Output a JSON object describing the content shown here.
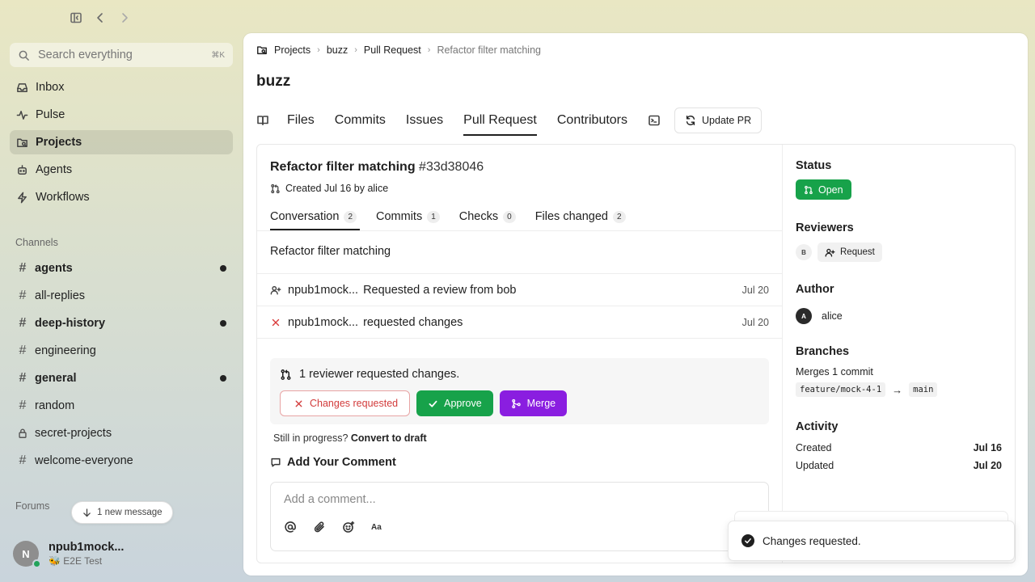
{
  "search": {
    "placeholder": "Search everything",
    "shortcut": "⌘K"
  },
  "nav": [
    {
      "label": "Inbox",
      "icon": "inbox-icon"
    },
    {
      "label": "Pulse",
      "icon": "pulse-icon"
    },
    {
      "label": "Projects",
      "icon": "projects-icon",
      "active": true
    },
    {
      "label": "Agents",
      "icon": "agents-icon"
    },
    {
      "label": "Workflows",
      "icon": "bolt-icon"
    }
  ],
  "channels_label": "Channels",
  "channels": [
    {
      "label": "agents",
      "unread": true
    },
    {
      "label": "all-replies",
      "unread": false
    },
    {
      "label": "deep-history",
      "unread": true
    },
    {
      "label": "engineering",
      "unread": false
    },
    {
      "label": "general",
      "unread": true
    },
    {
      "label": "random",
      "unread": false
    },
    {
      "label": "secret-projects",
      "unread": false,
      "locked": true
    },
    {
      "label": "welcome-everyone",
      "unread": false
    }
  ],
  "forums_label": "Forums",
  "new_message": "1 new message",
  "user": {
    "initial": "N",
    "name": "npub1mock...",
    "status": "🐝 E2E Test"
  },
  "breadcrumb": [
    "Projects",
    "buzz",
    "Pull Request",
    "Refactor filter matching"
  ],
  "page_title": "buzz",
  "tabs": [
    "Files",
    "Commits",
    "Issues",
    "Pull Request",
    "Contributors"
  ],
  "update_pr": "Update PR",
  "pr": {
    "title": "Refactor filter matching",
    "hash": "#33d38046",
    "created": "Created Jul 16 by alice",
    "subtabs": [
      {
        "label": "Conversation",
        "count": "2"
      },
      {
        "label": "Commits",
        "count": "1"
      },
      {
        "label": "Checks",
        "count": "0"
      },
      {
        "label": "Files changed",
        "count": "2"
      }
    ],
    "description": "Refactor filter matching",
    "events": [
      {
        "who": "npub1mock...",
        "text": "Requested a review from bob",
        "date": "Jul 20"
      },
      {
        "who": "npub1mock...",
        "text": "requested changes",
        "date": "Jul 20"
      }
    ],
    "merge_summary": "1 reviewer requested changes.",
    "btn_changes": "Changes requested",
    "btn_approve": "Approve",
    "btn_merge": "Merge",
    "draft_prefix": "Still in progress?",
    "draft_link": "Convert to draft",
    "add_comment": "Add Your Comment",
    "comment_placeholder": "Add a comment...",
    "comment_format": "Aa"
  },
  "side": {
    "status_h": "Status",
    "status": "Open",
    "reviewers_h": "Reviewers",
    "reviewer_initial": "B",
    "request": "Request",
    "author_h": "Author",
    "author_initial": "A",
    "author": "alice",
    "branches_h": "Branches",
    "merges": "Merges 1 commit",
    "from": "feature/mock-4-1",
    "arrow": "→",
    "to": "main",
    "activity_h": "Activity",
    "created_l": "Created",
    "created_v": "Jul 16",
    "updated_l": "Updated",
    "updated_v": "Jul 20"
  },
  "toast": "Changes requested.",
  "colors": {
    "green": "#17a24a",
    "purple": "#8a1ee0",
    "red": "#d23b3b"
  }
}
